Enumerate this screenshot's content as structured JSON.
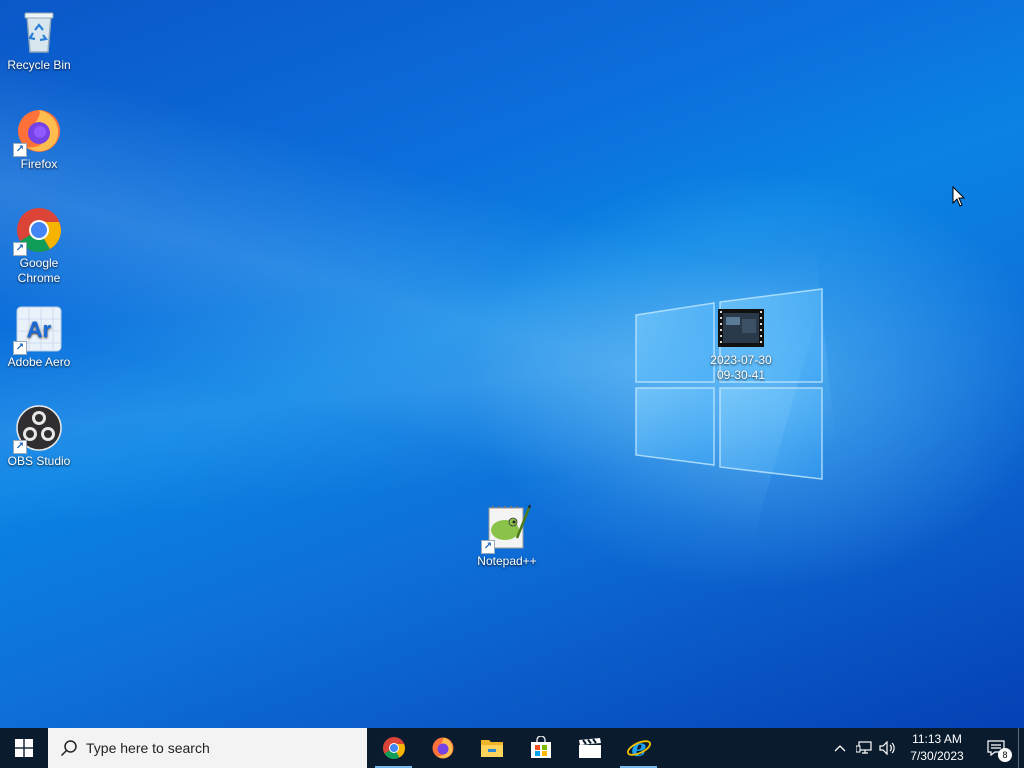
{
  "desktop": {
    "icons": [
      {
        "label": "Recycle Bin",
        "icon": "recycle-bin-icon"
      },
      {
        "label": "Firefox",
        "icon": "firefox-icon"
      },
      {
        "label": "Google Chrome",
        "icon": "chrome-icon"
      },
      {
        "label": "Adobe Aero",
        "icon": "adobe-aero-icon",
        "glyph": "Ar"
      },
      {
        "label": "OBS Studio",
        "icon": "obs-studio-icon"
      },
      {
        "label": "2023-07-30 09-30-41",
        "icon": "video-file-icon"
      },
      {
        "label": "Notepad++",
        "icon": "notepad-plus-plus-icon"
      }
    ]
  },
  "taskbar": {
    "search_placeholder": "Type here to search",
    "apps": [
      {
        "name": "Google Chrome",
        "icon": "chrome-icon",
        "active": true
      },
      {
        "name": "Firefox",
        "icon": "firefox-icon",
        "active": false
      },
      {
        "name": "File Explorer",
        "icon": "folder-icon",
        "active": false
      },
      {
        "name": "Microsoft Store",
        "icon": "store-icon",
        "active": false
      },
      {
        "name": "Video Editor",
        "icon": "clapperboard-icon",
        "active": false
      },
      {
        "name": "Internet Explorer",
        "icon": "internet-explorer-icon",
        "active": true
      }
    ],
    "clock": {
      "time": "11:13 AM",
      "date": "7/30/2023"
    },
    "notification_count": "8"
  },
  "colors": {
    "taskbar": "#0b1b2e",
    "accent": "#76b9ed",
    "wallpaper": "#0a6fd8"
  }
}
